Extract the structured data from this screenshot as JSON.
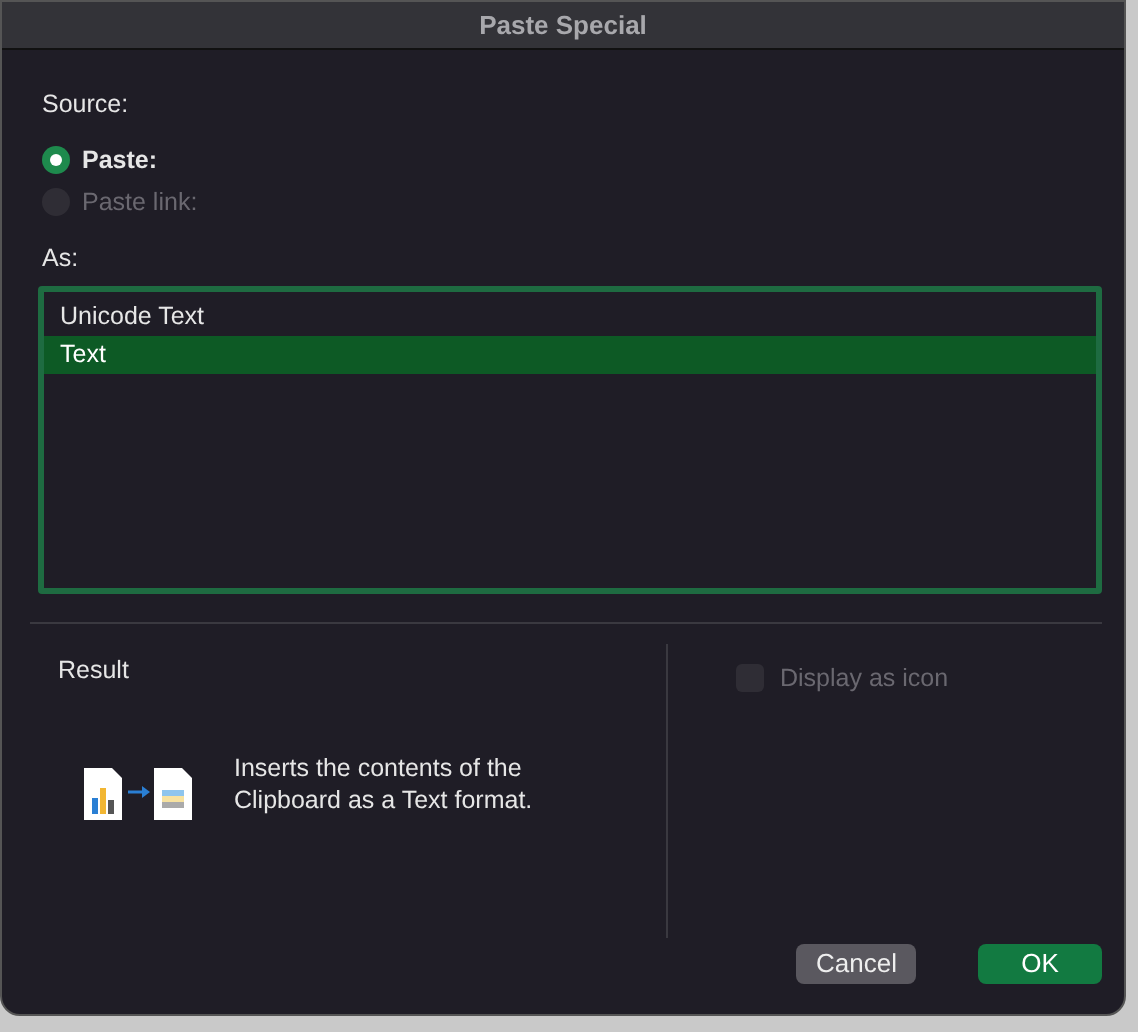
{
  "window": {
    "title": "Paste Special"
  },
  "source": {
    "label": "Source:",
    "options": [
      {
        "label": "Paste:",
        "selected": true,
        "disabled": false
      },
      {
        "label": "Paste link:",
        "selected": false,
        "disabled": true
      }
    ]
  },
  "as": {
    "label": "As:",
    "items": [
      {
        "label": "Unicode Text",
        "selected": false
      },
      {
        "label": "Text",
        "selected": true
      }
    ]
  },
  "result": {
    "label": "Result",
    "description": "Inserts the contents of the Clipboard as a Text format."
  },
  "display_as_icon": {
    "label": "Display as icon",
    "checked": false,
    "disabled": true
  },
  "buttons": [
    {
      "label": "Cancel",
      "kind": "secondary"
    },
    {
      "label": "OK",
      "kind": "primary"
    }
  ]
}
